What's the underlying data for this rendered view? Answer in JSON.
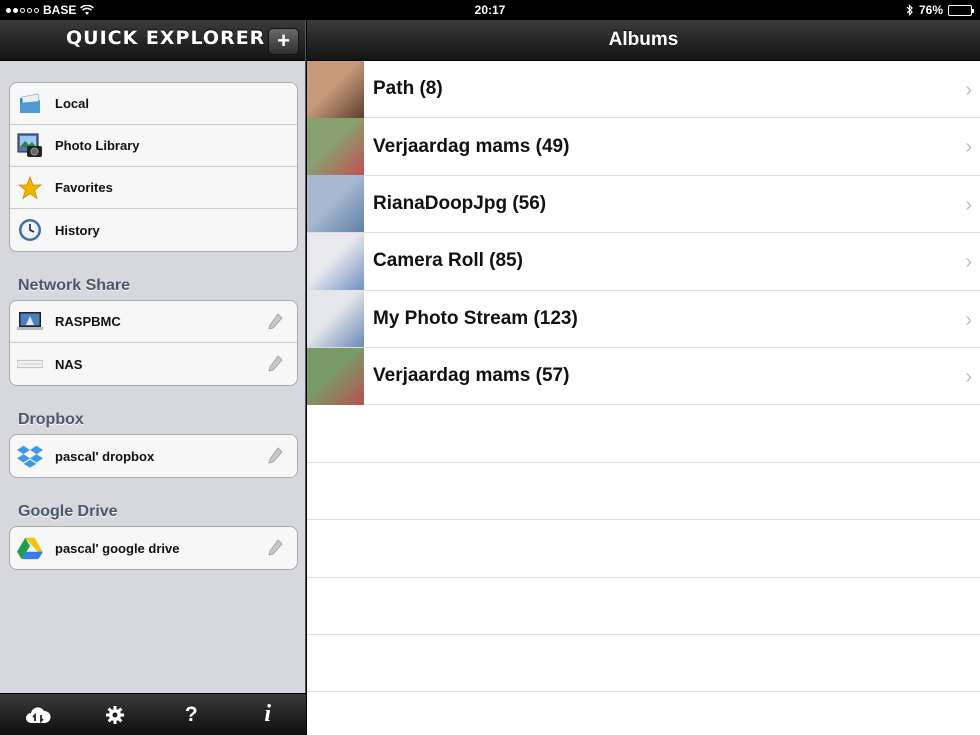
{
  "status": {
    "carrier": "BASE",
    "time": "20:17",
    "battery": "76%",
    "battery_level": 0.76
  },
  "sidebar": {
    "title": "QUICK EXPLORER",
    "add_label": "+",
    "local_items": [
      {
        "label": "Local",
        "icon": "folder-icon"
      },
      {
        "label": "Photo Library",
        "icon": "photo-library-icon"
      },
      {
        "label": "Favorites",
        "icon": "star-icon"
      },
      {
        "label": "History",
        "icon": "clock-icon"
      }
    ],
    "network_title": "Network Share",
    "network_items": [
      {
        "label": "RASPBMC",
        "icon": "computer-icon"
      },
      {
        "label": "NAS",
        "icon": "nas-icon"
      }
    ],
    "dropbox_title": "Dropbox",
    "dropbox_items": [
      {
        "label": "pascal' dropbox",
        "icon": "dropbox-icon"
      }
    ],
    "gdrive_title": "Google Drive",
    "gdrive_items": [
      {
        "label": "pascal' google drive",
        "icon": "google-drive-icon"
      }
    ],
    "toolbar": {
      "help": "?",
      "info": "i"
    }
  },
  "main": {
    "title": "Albums",
    "albums": [
      {
        "name": "Path (8)",
        "colors": [
          "#c89a7a",
          "#5a4030"
        ]
      },
      {
        "name": "Verjaardag mams (49)",
        "colors": [
          "#8aa070",
          "#c05050"
        ]
      },
      {
        "name": "RianaDoopJpg (56)",
        "colors": [
          "#a8b8d0",
          "#6080a8"
        ]
      },
      {
        "name": "Camera Roll (85)",
        "colors": [
          "#e8e8ee",
          "#7090c0"
        ]
      },
      {
        "name": "My Photo Stream (123)",
        "colors": [
          "#e4e6ea",
          "#6a88b8"
        ]
      },
      {
        "name": "Verjaardag mams (57)",
        "colors": [
          "#7a9a68",
          "#b85050"
        ]
      }
    ],
    "chevron": "›"
  }
}
